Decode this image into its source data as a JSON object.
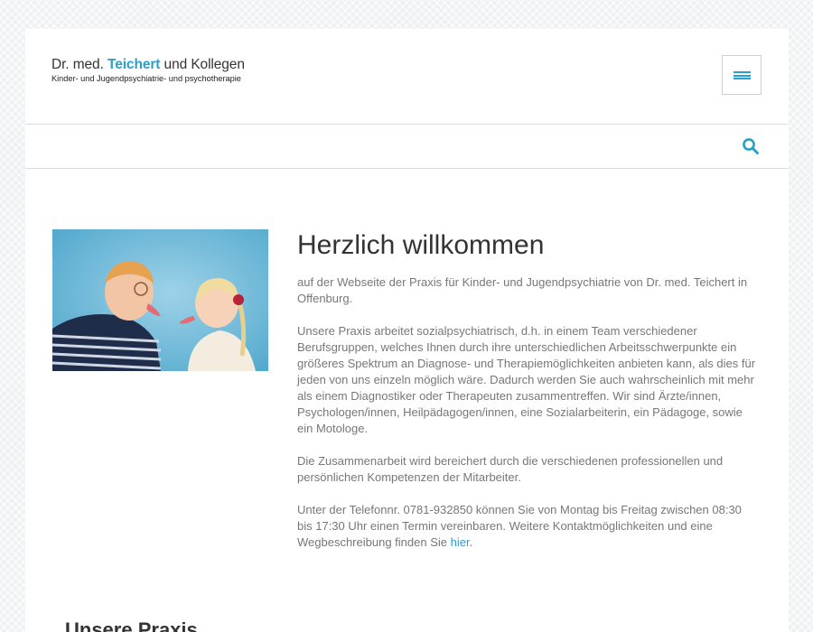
{
  "logo": {
    "prefix": "Dr. med. ",
    "accent": "Teichert",
    "suffix": " und Kollegen",
    "subtitle": "Kinder- und Jugendpsychiatrie- und psychotherapie"
  },
  "colors": {
    "accent": "#2a9fc9",
    "text": "#333333",
    "body_text": "#777777"
  },
  "icons": {
    "menu": "hamburger-menu-icon",
    "search": "search-icon"
  },
  "main": {
    "title": "Herzlich willkommen",
    "paragraphs": [
      "auf der Webseite der Praxis für Kinder- und Jugendpsychiatrie von Dr. med. Teichert in Offenburg.",
      "Unsere Praxis arbeitet sozialpsychiatrisch, d.h. in einem Team verschiedener Berufsgruppen, welches Ihnen durch ihre unterschiedlichen Arbeitsschwerpunkte ein größeres Spektrum an Diagnose- und Therapiemöglichkeiten anbieten kann, als dies für jeden von uns einzeln möglich wäre. Dadurch werden Sie auch wahrscheinlich mit mehr als einem Diagnostiker oder Therapeuten zusammentreffen. Wir sind Ärzte/innen, Psychologen/innen, Heilpädagogen/innen, eine Sozialarbeiterin, ein Pädagoge, sowie ein Motologe.",
      "Die Zusammenarbeit wird bereichert durch die verschiedenen professionellen und persönlichen Kompetenzen der Mitarbeiter."
    ],
    "contact_text": "Unter der Telefonnr. 0781-932850 können Sie von Montag bis Freitag zwischen 08:30 bis 17:30 Uhr einen Termin vereinbaren. Weitere Kontaktmöglichkeiten und eine Wegbeschreibung finden Sie ",
    "contact_link": "hier",
    "contact_end": "."
  },
  "section": {
    "title": "Unsere Praxis"
  }
}
